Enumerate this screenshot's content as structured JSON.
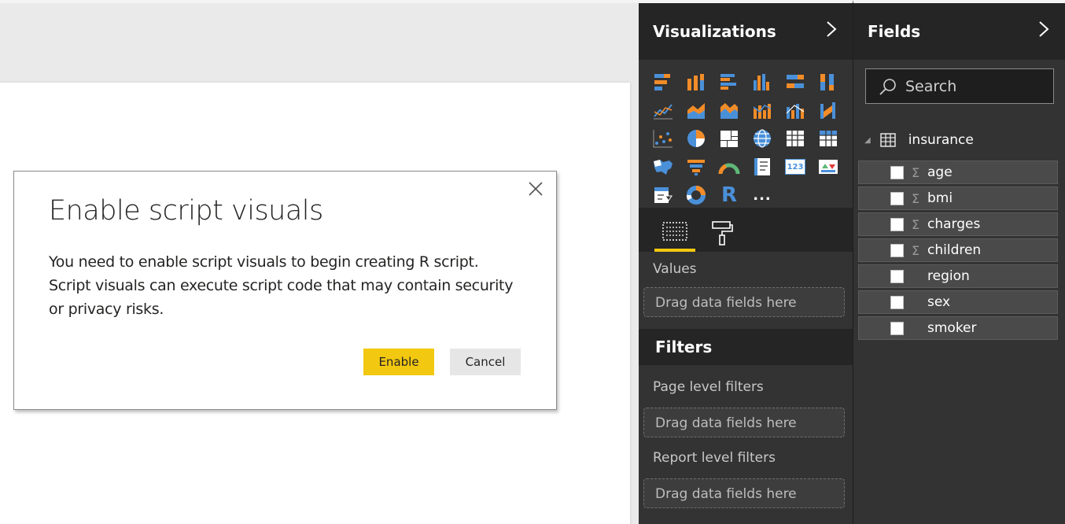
{
  "dialog": {
    "title": "Enable script visuals",
    "body": "You need to enable script visuals to begin creating R script. Script visuals can execute script code that may contain security or privacy risks.",
    "enable_label": "Enable",
    "cancel_label": "Cancel"
  },
  "visualizations": {
    "title": "Visualizations",
    "more_label": "...",
    "r_label": "R",
    "card_label": "123",
    "values_label": "Values",
    "drop_label": "Drag data fields here"
  },
  "filters": {
    "title": "Filters",
    "page_label": "Page level filters",
    "report_label": "Report level filters",
    "drop_label": "Drag data fields here"
  },
  "fields": {
    "title": "Fields",
    "search_placeholder": "Search",
    "table_name": "insurance",
    "items": [
      {
        "name": "age",
        "sigma": "Σ"
      },
      {
        "name": "bmi",
        "sigma": "Σ"
      },
      {
        "name": "charges",
        "sigma": "Σ"
      },
      {
        "name": "children",
        "sigma": "Σ"
      },
      {
        "name": "region",
        "sigma": ""
      },
      {
        "name": "sex",
        "sigma": ""
      },
      {
        "name": "smoker",
        "sigma": ""
      }
    ]
  },
  "colors": {
    "accent": "#f2c811",
    "orange": "#f28c28",
    "blue": "#4a90d9",
    "pane": "#333333",
    "header": "#252525"
  }
}
